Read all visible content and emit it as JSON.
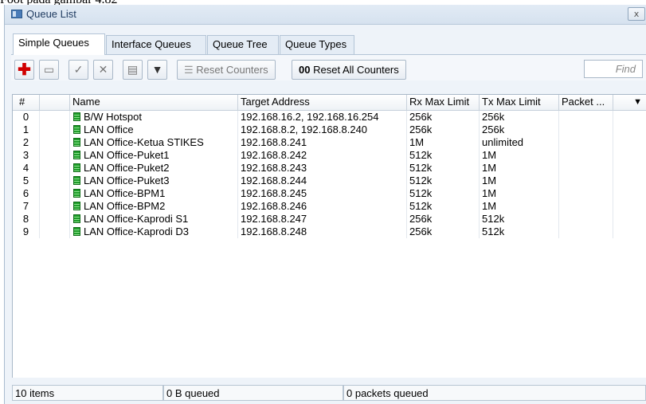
{
  "caption": "Foot pada gambar 4.82",
  "window": {
    "title": "Queue List",
    "close_label": "ⅹ"
  },
  "tabs": [
    "Simple Queues",
    "Interface Queues",
    "Queue Tree",
    "Queue Types"
  ],
  "toolbar": {
    "reset_counters": "Reset Counters",
    "reset_all_counters": "Reset All Counters",
    "reset_all_prefix": "00",
    "find_placeholder": "Find"
  },
  "columns": [
    "#",
    "Name",
    "Target Address",
    "Rx Max Limit",
    "Tx Max Limit",
    "Packet ..."
  ],
  "rows": [
    {
      "num": "0",
      "name": "B/W Hotspot",
      "target": "192.168.16.2, 192.168.16.254",
      "rx": "256k",
      "tx": "256k"
    },
    {
      "num": "1",
      "name": "LAN Office",
      "target": "192.168.8.2, 192.168.8.240",
      "rx": "256k",
      "tx": "256k"
    },
    {
      "num": "2",
      "name": "LAN Office-Ketua STIKES",
      "target": "192.168.8.241",
      "rx": "1M",
      "tx": "unlimited"
    },
    {
      "num": "3",
      "name": "LAN Office-Puket1",
      "target": "192.168.8.242",
      "rx": "512k",
      "tx": "1M"
    },
    {
      "num": "4",
      "name": "LAN Office-Puket2",
      "target": "192.168.8.243",
      "rx": "512k",
      "tx": "1M"
    },
    {
      "num": "5",
      "name": "LAN Office-Puket3",
      "target": "192.168.8.244",
      "rx": "512k",
      "tx": "1M"
    },
    {
      "num": "6",
      "name": "LAN Office-BPM1",
      "target": "192.168.8.245",
      "rx": "512k",
      "tx": "1M"
    },
    {
      "num": "7",
      "name": "LAN Office-BPM2",
      "target": "192.168.8.246",
      "rx": "512k",
      "tx": "1M"
    },
    {
      "num": "8",
      "name": "LAN Office-Kaprodi S1",
      "target": "192.168.8.247",
      "rx": "256k",
      "tx": "512k"
    },
    {
      "num": "9",
      "name": "LAN Office-Kaprodi D3",
      "target": "192.168.8.248",
      "rx": "256k",
      "tx": "512k"
    }
  ],
  "status": {
    "items": "10 items",
    "queued": "0 B queued",
    "packets": "0 packets queued"
  },
  "colors": {
    "accent": "#d00000",
    "queue_icon": "#1f9e2a"
  }
}
